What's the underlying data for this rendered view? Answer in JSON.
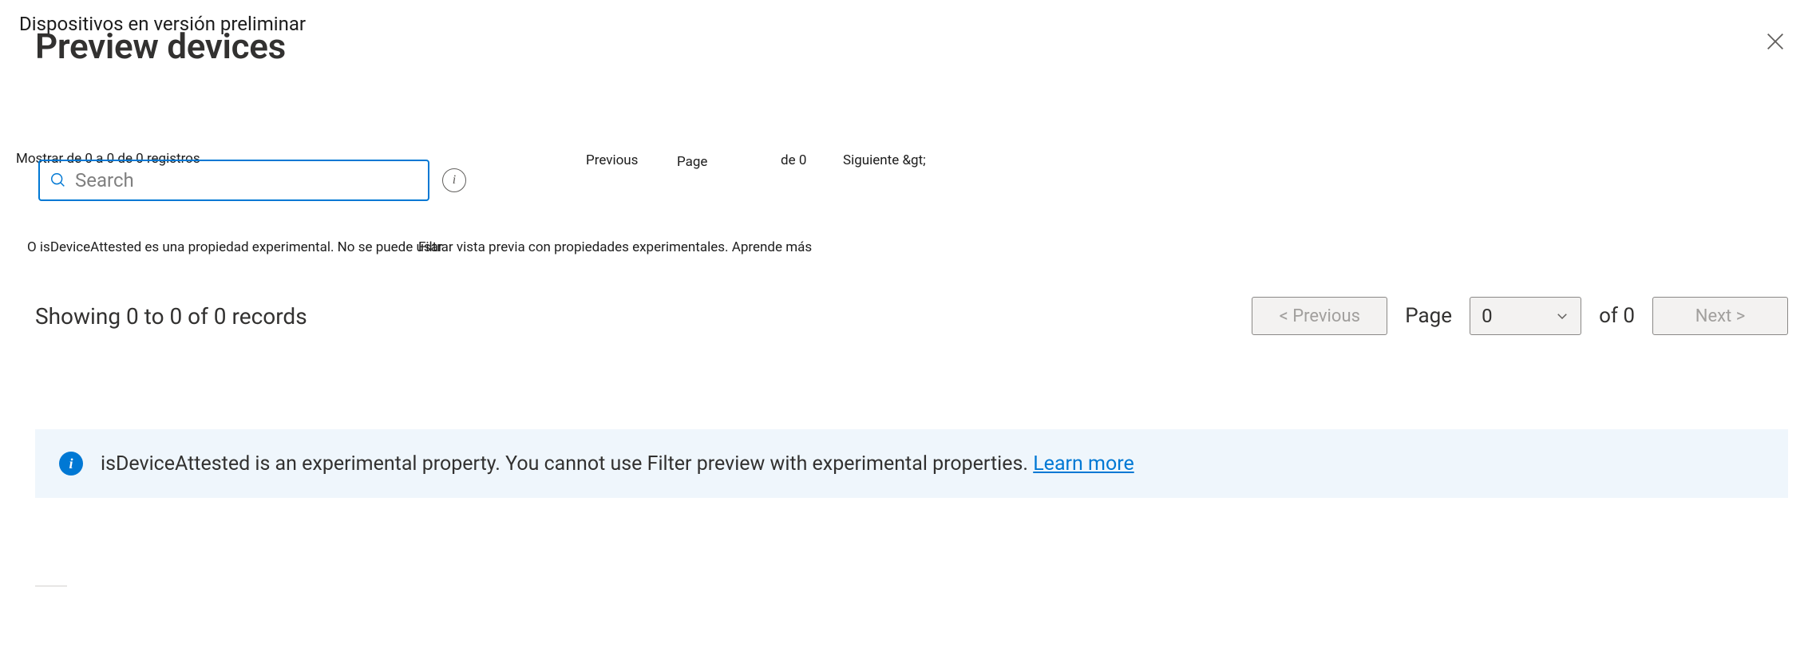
{
  "ghost": {
    "breadcrumb": "Dispositivos en versión preliminar",
    "records_label": "Mostrar de 0 a 0 de 0 registros",
    "prev_small": "Previous",
    "page_small": "Page",
    "de_small": "de 0",
    "next_small": "Siguiente &gt;",
    "hint_left": "O isDeviceAttested es una propiedad experimental. No se puede usar",
    "hint_right": "Filtrar vista previa con propiedades experimentales. Aprende más"
  },
  "header": {
    "title": "Preview devices"
  },
  "search": {
    "placeholder": "Search",
    "value": ""
  },
  "records": {
    "text": "Showing 0 to 0 of 0 records"
  },
  "pager": {
    "previous": "<  Previous",
    "page_label": "Page",
    "page_value": "0",
    "of_text": "of 0",
    "next": "Next  >"
  },
  "banner": {
    "text": "isDeviceAttested is an experimental property. You cannot use Filter preview with experimental properties. ",
    "link": "Learn more"
  }
}
